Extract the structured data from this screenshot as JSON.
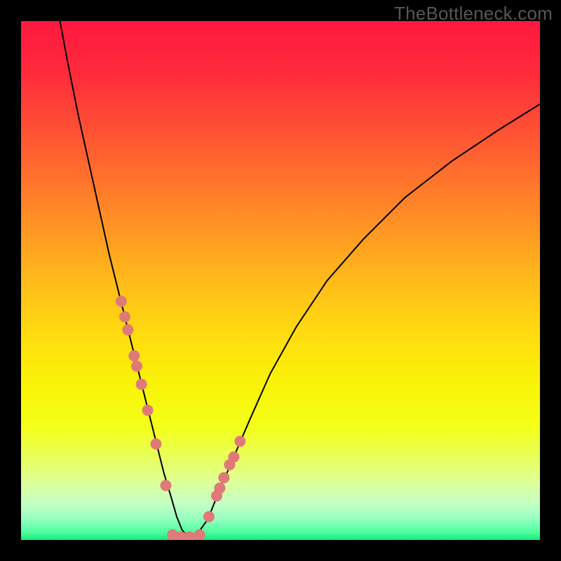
{
  "watermark": "TheBottleneck.com",
  "gradient": {
    "stops": [
      {
        "offset": 0.0,
        "color": "#ff183f"
      },
      {
        "offset": 0.1,
        "color": "#ff2b3b"
      },
      {
        "offset": 0.22,
        "color": "#ff5433"
      },
      {
        "offset": 0.35,
        "color": "#ff8328"
      },
      {
        "offset": 0.48,
        "color": "#ffb31c"
      },
      {
        "offset": 0.6,
        "color": "#ffdb10"
      },
      {
        "offset": 0.7,
        "color": "#f9f307"
      },
      {
        "offset": 0.78,
        "color": "#f4ff17"
      },
      {
        "offset": 0.84,
        "color": "#e9ff5a"
      },
      {
        "offset": 0.89,
        "color": "#dcff9a"
      },
      {
        "offset": 0.93,
        "color": "#c4ffc4"
      },
      {
        "offset": 0.96,
        "color": "#93ffc0"
      },
      {
        "offset": 0.985,
        "color": "#4dff9e"
      },
      {
        "offset": 1.0,
        "color": "#18e87a"
      }
    ]
  },
  "chart_data": {
    "type": "line",
    "title": "",
    "xlabel": "",
    "ylabel": "",
    "xlim": [
      0,
      100
    ],
    "ylim": [
      0,
      100
    ],
    "series": [
      {
        "name": "bottleneck-curve",
        "x": [
          7.5,
          9,
          11,
          13,
          15,
          17,
          19,
          21,
          23,
          24.5,
          26,
          27.5,
          29,
          30,
          31,
          32,
          33,
          34,
          36,
          38,
          41,
          44,
          48,
          53,
          59,
          66,
          74,
          83,
          92,
          100
        ],
        "y": [
          100,
          92,
          82,
          73,
          64,
          55,
          47,
          39,
          31,
          25,
          19,
          13,
          8,
          4.5,
          2,
          0.7,
          0.5,
          1.2,
          4,
          9,
          16,
          23,
          32,
          41,
          50,
          58,
          66,
          73,
          79,
          84
        ]
      },
      {
        "name": "data-points-left",
        "type": "scatter",
        "color": "#e07a78",
        "x": [
          19.3,
          20.0,
          20.6,
          21.8,
          22.3,
          23.2,
          24.4,
          26.0,
          27.9
        ],
        "y": [
          46.0,
          43.0,
          40.5,
          35.5,
          33.5,
          30.0,
          25.0,
          18.5,
          10.5
        ]
      },
      {
        "name": "data-points-right",
        "type": "scatter",
        "color": "#e07a78",
        "x": [
          36.2,
          37.7,
          38.3,
          39.1,
          40.2,
          41.0,
          42.2
        ],
        "y": [
          4.5,
          8.5,
          10.0,
          12.0,
          14.5,
          16.0,
          19.0
        ]
      },
      {
        "name": "data-points-bottom",
        "type": "scatter",
        "color": "#e07a78",
        "x": [
          29.2,
          30.8,
          32.5,
          34.4
        ],
        "y": [
          1.0,
          0.6,
          0.6,
          1.0
        ]
      }
    ]
  }
}
